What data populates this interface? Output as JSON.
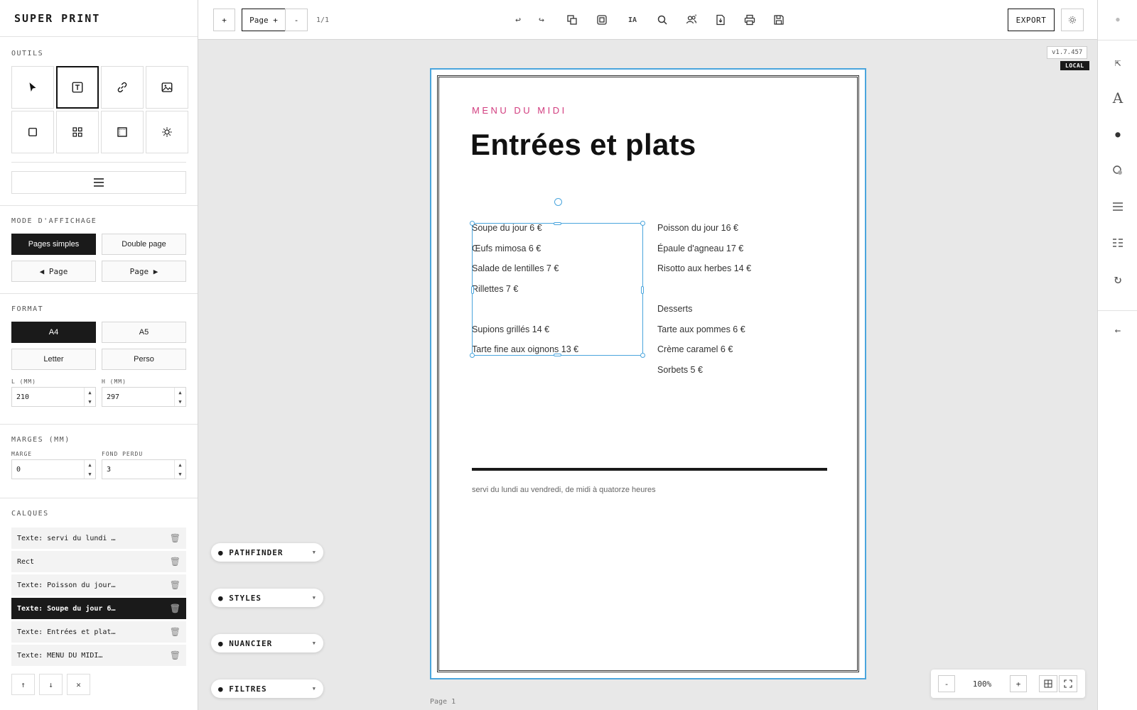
{
  "app": {
    "title": "SUPER PRINT",
    "version": "v1.7.457",
    "env_badge": "LOCAL"
  },
  "sidebar": {
    "tools_title": "OUTILS",
    "tools": [
      {
        "icon": "pointer-icon",
        "name": "tool-select"
      },
      {
        "icon": "text-icon",
        "name": "tool-text"
      },
      {
        "icon": "link-icon",
        "name": "tool-link"
      },
      {
        "icon": "image-icon",
        "name": "tool-image"
      },
      {
        "icon": "rectangle-icon",
        "name": "tool-rectangle"
      },
      {
        "icon": "grid-icon",
        "name": "tool-grid"
      },
      {
        "icon": "frame-icon",
        "name": "tool-frame"
      },
      {
        "icon": "sun-icon",
        "name": "tool-effect"
      }
    ],
    "active_tool": "tool-text",
    "display_mode": {
      "title": "MODE D'AFFICHAGE",
      "single": "Pages simples",
      "double": "Double page",
      "prev": "◀ Page",
      "next": "Page ▶"
    },
    "format": {
      "title": "FORMAT",
      "a4": "A4",
      "a5": "A5",
      "letter": "Letter",
      "custom": "Perso",
      "width_label": "L (MM)",
      "width_value": "210",
      "height_label": "H (MM)",
      "height_value": "297"
    },
    "margins": {
      "title": "MARGES (MM)",
      "margin_label": "MARGE",
      "margin_value": "0",
      "bleed_label": "FOND PERDU",
      "bleed_value": "3"
    },
    "layers": {
      "title": "CALQUES",
      "items": [
        "Texte: servi du lundi …",
        "Rect",
        "Texte: Poisson du jour…",
        "Texte: Soupe du jour 6…",
        "Texte: Entrées et plat…",
        "Texte: MENU DU MIDI…"
      ]
    }
  },
  "topbar": {
    "add": "+",
    "page_button": "Page +",
    "remove": "-",
    "page_count": "1/1",
    "ai": "IA",
    "export": "EXPORT"
  },
  "canvas": {
    "kicker": "MENU DU MIDI",
    "heading": "Entrées et plats",
    "left_items": [
      "Soupe du jour 6 €",
      "Œufs mimosa 6 €",
      "Salade de lentilles 7 €",
      "Rillettes 7 €",
      "",
      "Supions grillés 14 €",
      "Tarte fine aux oignons 13 €"
    ],
    "right_items": [
      "Poisson du jour 16 €",
      "Épaule d'agneau 17 €",
      "Risotto aux herbes 14 €",
      "",
      "Desserts",
      "Tarte aux pommes 6 €",
      "Crème caramel 6 €",
      "Sorbets 5 €"
    ],
    "footer": "servi du lundi au vendredi, de midi à quatorze heures",
    "page_label": "Page 1",
    "accent": "#d23d7f",
    "selection": "#4aa5dd"
  },
  "panels": [
    "PATHFINDER",
    "STYLES",
    "NUANCIER",
    "FILTRES"
  ],
  "zoom": {
    "minus": "-",
    "value": "100%",
    "plus": "+"
  }
}
